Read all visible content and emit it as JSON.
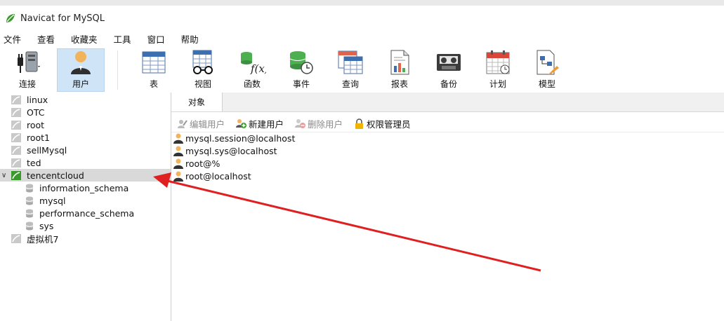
{
  "window": {
    "title": "Navicat for MySQL"
  },
  "menu": [
    "文件",
    "查看",
    "收藏夹",
    "工具",
    "窗口",
    "帮助"
  ],
  "toolbar": {
    "connect": "连接",
    "user": "用户",
    "table": "表",
    "view": "视图",
    "function": "函数",
    "event": "事件",
    "query": "查询",
    "report": "报表",
    "backup": "备份",
    "schedule": "计划",
    "model": "模型"
  },
  "sidebar": {
    "connections": [
      "linux",
      "OTC",
      "root",
      "root1",
      "sellMysql",
      "ted"
    ],
    "open_connection": "tencentcloud",
    "databases": [
      "information_schema",
      "mysql",
      "performance_schema",
      "sys"
    ],
    "last_connection": "虚拟机7"
  },
  "main": {
    "tab_label": "对象",
    "actions": {
      "edit_user": "编辑用户",
      "new_user": "新建用户",
      "delete_user": "删除用户",
      "privilege_manager": "权限管理员"
    },
    "users": [
      "mysql.session@localhost",
      "mysql.sys@localhost",
      "root@%",
      "root@localhost"
    ]
  },
  "colors": {
    "selection": "#d9d9d9",
    "active_tool": "#cfe4f6",
    "annotation_arrow": "#e02020",
    "logo_green": "#3a9a2c"
  }
}
